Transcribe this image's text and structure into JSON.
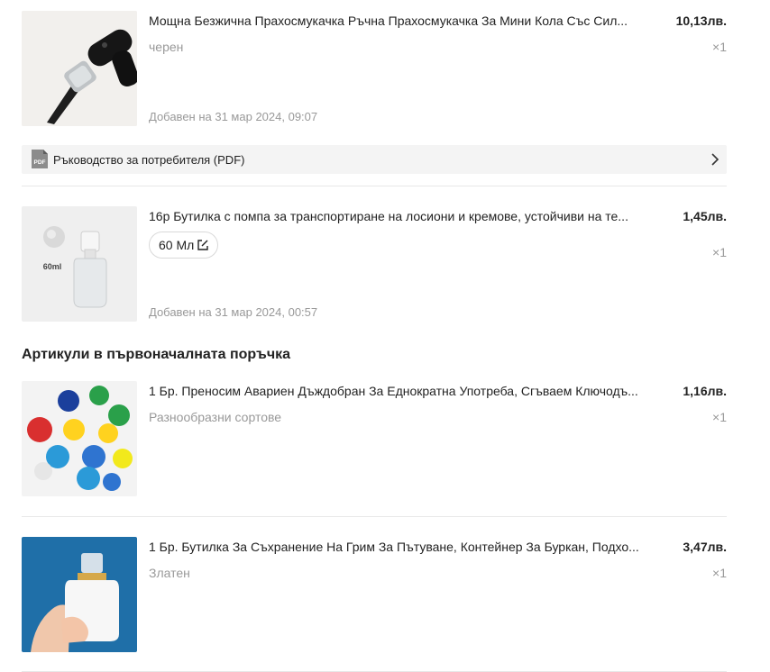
{
  "items": [
    {
      "title": "Мощна Безжична Прахосмукачка Ръчна Прахосмукачка За Мини Кола Със Сил...",
      "price": "10,13лв.",
      "variant": "черен",
      "quantity": "×1",
      "added": "Добавен на 31 мар 2024, 09:07"
    },
    {
      "title": "16р Бутилка с помпа за транспортиране на лосиони и кремове, устойчиви на те...",
      "price": "1,45лв.",
      "variant_chip": "60 Мл",
      "quantity": "×1",
      "added": "Добавен на 31 мар 2024, 00:57",
      "image_text": "60ml"
    }
  ],
  "manual": {
    "label": "Ръководство за потребителя (PDF)",
    "icon_text": "PDF"
  },
  "original_order": {
    "title": "Артикули в първоначалната поръчка",
    "items": [
      {
        "title": "1 Бр. Преносим Авариен Дъждобран За Еднократна Употреба, Сгъваем Ключодъ...",
        "price": "1,16лв.",
        "variant": "Разнообразни сортове",
        "quantity": "×1"
      },
      {
        "title": "1 Бр. Бутилка За Съхранение На Грим За Пътуване, Контейнер За Буркан, Подхо...",
        "price": "3,47лв.",
        "variant": "Златен",
        "quantity": "×1"
      }
    ]
  },
  "icons": [
    "pdf-file-icon",
    "chevron-right-icon",
    "edit-icon"
  ],
  "colors": {
    "text": "#222222",
    "muted": "#999999",
    "divider": "#e8e8e8",
    "manual_bg": "#f4f4f4"
  }
}
